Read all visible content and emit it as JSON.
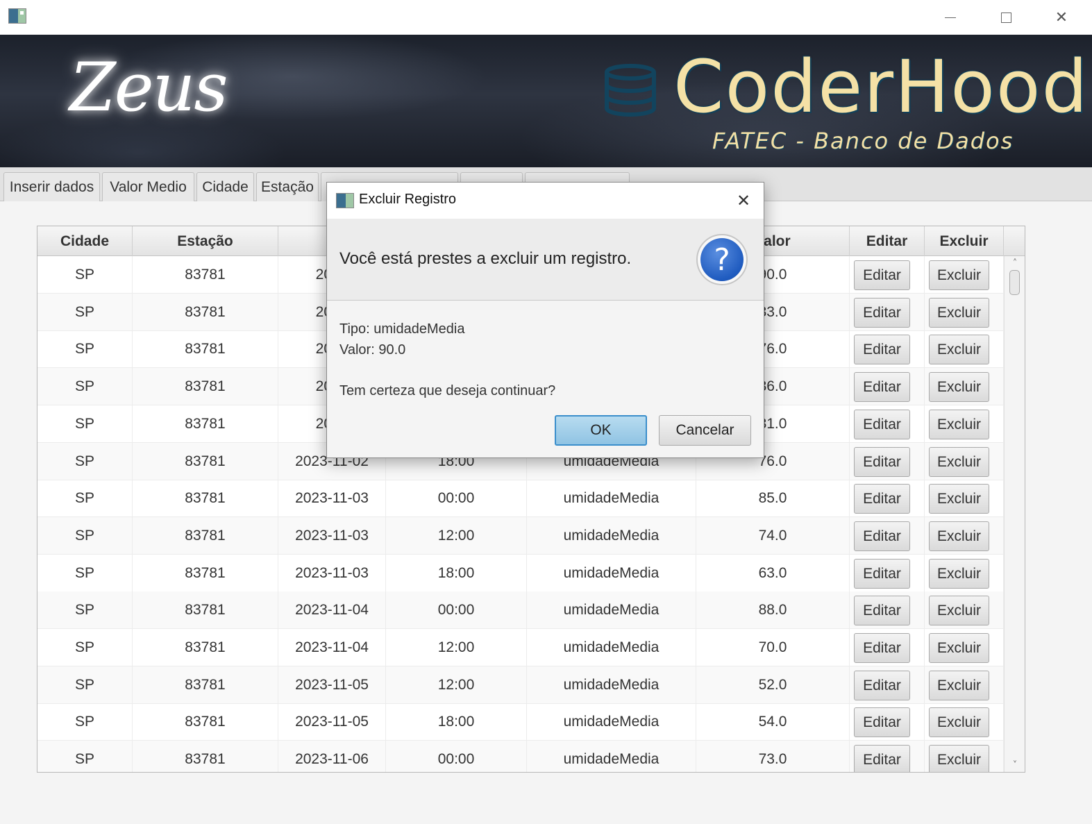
{
  "window": {
    "close_glyph": "✕"
  },
  "banner": {
    "zeus_logo": "Zeus",
    "brand": "CoderHood",
    "subtitle": "FATEC - Banco de Dados"
  },
  "tabs": [
    {
      "label": "Inserir dados"
    },
    {
      "label": "Valor Medio"
    },
    {
      "label": "Cidade"
    },
    {
      "label": "Estação"
    },
    {
      "label": ""
    },
    {
      "label": ""
    },
    {
      "label": ""
    }
  ],
  "table": {
    "columns": [
      "Cidade",
      "Estação",
      "D",
      "",
      "",
      "Valor",
      "Editar",
      "Excluir"
    ],
    "rows": [
      {
        "cidade": "SP",
        "estacao": "83781",
        "data": "2023",
        "hora": "",
        "tipo": "",
        "valor": "90.0"
      },
      {
        "cidade": "SP",
        "estacao": "83781",
        "data": "2023",
        "hora": "",
        "tipo": "",
        "valor": "33.0"
      },
      {
        "cidade": "SP",
        "estacao": "83781",
        "data": "2023",
        "hora": "",
        "tipo": "",
        "valor": "76.0"
      },
      {
        "cidade": "SP",
        "estacao": "83781",
        "data": "2023",
        "hora": "",
        "tipo": "",
        "valor": "36.0"
      },
      {
        "cidade": "SP",
        "estacao": "83781",
        "data": "2023",
        "hora": "",
        "tipo": "",
        "valor": "31.0"
      },
      {
        "cidade": "SP",
        "estacao": "83781",
        "data": "2023-11-02",
        "hora": "18:00",
        "tipo": "umidadeMedia",
        "valor": "76.0"
      },
      {
        "cidade": "SP",
        "estacao": "83781",
        "data": "2023-11-03",
        "hora": "00:00",
        "tipo": "umidadeMedia",
        "valor": "85.0"
      },
      {
        "cidade": "SP",
        "estacao": "83781",
        "data": "2023-11-03",
        "hora": "12:00",
        "tipo": "umidadeMedia",
        "valor": "74.0"
      },
      {
        "cidade": "SP",
        "estacao": "83781",
        "data": "2023-11-03",
        "hora": "18:00",
        "tipo": "umidadeMedia",
        "valor": "63.0"
      },
      {
        "cidade": "SP",
        "estacao": "83781",
        "data": "2023-11-04",
        "hora": "00:00",
        "tipo": "umidadeMedia",
        "valor": "88.0"
      },
      {
        "cidade": "SP",
        "estacao": "83781",
        "data": "2023-11-04",
        "hora": "12:00",
        "tipo": "umidadeMedia",
        "valor": "70.0"
      },
      {
        "cidade": "SP",
        "estacao": "83781",
        "data": "2023-11-05",
        "hora": "12:00",
        "tipo": "umidadeMedia",
        "valor": "52.0"
      },
      {
        "cidade": "SP",
        "estacao": "83781",
        "data": "2023-11-05",
        "hora": "18:00",
        "tipo": "umidadeMedia",
        "valor": "54.0"
      },
      {
        "cidade": "SP",
        "estacao": "83781",
        "data": "2023-11-06",
        "hora": "00:00",
        "tipo": "umidadeMedia",
        "valor": "73.0"
      }
    ],
    "edit_label": "Editar",
    "delete_label": "Excluir"
  },
  "dialog": {
    "title": "Excluir Registro",
    "header": "Você está prestes a excluir um registro.",
    "question_glyph": "?",
    "tipo_line": "Tipo: umidadeMedia",
    "valor_line": "Valor: 90.0",
    "confirm_line": "Tem certeza que deseja continuar?",
    "ok_label": "OK",
    "cancel_label": "Cancelar",
    "close_glyph": "✕"
  },
  "colors": {
    "accent_ok": "#8fc3e3",
    "brand_text": "#f4e1a6",
    "question_blue": "#1f5bbf"
  }
}
